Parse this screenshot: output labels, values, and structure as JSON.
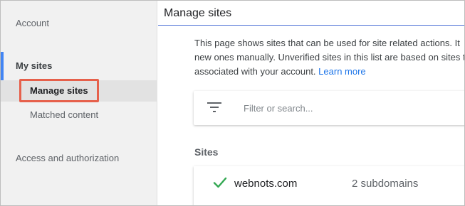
{
  "sidebar": {
    "account": "Account",
    "my_sites": "My sites",
    "manage_sites": "Manage sites",
    "matched_content": "Matched content",
    "access": "Access and authorization"
  },
  "header": {
    "title": "Manage sites"
  },
  "main": {
    "description_lines": [
      "This page shows sites that can be used for site related actions. It",
      "new ones manually. Unverified sites in this list are based on sites t",
      "associated with your account."
    ],
    "learn_more": "Learn more",
    "search": {
      "placeholder": "Filter or search...",
      "icon": "filter-icon"
    },
    "sites_heading": "Sites",
    "sites": [
      {
        "name": "webnots.com",
        "subdomains": "2 subdomains",
        "status_icon": "check-icon"
      }
    ]
  },
  "colors": {
    "accent": "#4285f4",
    "link": "#1a73e8",
    "highlight_box": "#e6604b",
    "check": "#34a853"
  }
}
